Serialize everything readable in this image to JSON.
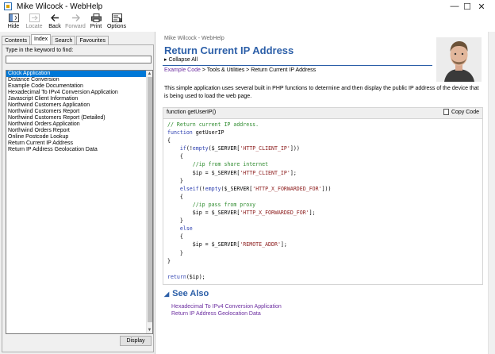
{
  "window": {
    "title": "Mike Wilcock - WebHelp",
    "minimize_glyph": "—",
    "maximize_glyph": "☐",
    "close_glyph": "✕"
  },
  "toolbar": {
    "hide": "Hide",
    "locate": "Locate",
    "back": "Back",
    "forward": "Forward",
    "print": "Print",
    "options": "Options"
  },
  "left": {
    "tabs": [
      "Contents",
      "Index",
      "Search",
      "Favourites"
    ],
    "keyword_label": "Type in the keyword to find:",
    "keyword_value": "",
    "items": [
      "Clock Application",
      "Distance Conversion",
      "Example Code Documentation",
      "Hexadecimal To IPv4 Conversion Application",
      "Javascript Client Information",
      "Northwind Customers Application",
      "Northwind Customers Report",
      "Northwind Customers Report (Detailed)",
      "Northwind Orders Application",
      "Northwind Orders Report",
      "Online Postcode Lookup",
      "Return Current IP Address",
      "Return IP Address Geolocation Data"
    ],
    "selected_index": 0,
    "display_button": "Display"
  },
  "content": {
    "top_caption": "Mike Wilcock - WebHelp",
    "title": "Return Current IP Address",
    "collapse_all": "Collapse All",
    "breadcrumb": {
      "link": "Example Code",
      "rest": " > Tools & Utilities > Return Current IP Address"
    },
    "description": "This simple application uses several built in PHP functions to determine and then display the public IP address of the device that is being used to load the web page.",
    "code": {
      "header": "function getUserIP()",
      "copy_label": "Copy Code",
      "lines": [
        "// Return current IP address.",
        "function getUserIP",
        "{",
        "    if(!empty($_SERVER['HTTP_CLIENT_IP']))",
        "    {",
        "        //ip from share internet",
        "        $ip = $_SERVER['HTTP_CLIENT_IP'];",
        "    }",
        "    elseif(!empty($_SERVER['HTTP_X_FORWARDED_FOR']))",
        "    {",
        "        //ip pass from proxy",
        "        $ip = $_SERVER['HTTP_X_FORWARDED_FOR'];",
        "    }",
        "    else",
        "    {",
        "        $ip = $_SERVER['REMOTE_ADDR'];",
        "    }",
        "}",
        "",
        "return($ip);"
      ]
    },
    "see_also": {
      "heading": "See Also",
      "links": [
        "Hexadecimal To IPv4 Conversion Application",
        "Return IP Address Geolocation Data"
      ]
    }
  },
  "colors": {
    "accent": "#2c5fa8",
    "link": "#6c2ea0",
    "comment": "#2e8b2e",
    "keyword": "#2c3fb0",
    "string": "#8b1a1a",
    "selection": "#0078d7"
  }
}
